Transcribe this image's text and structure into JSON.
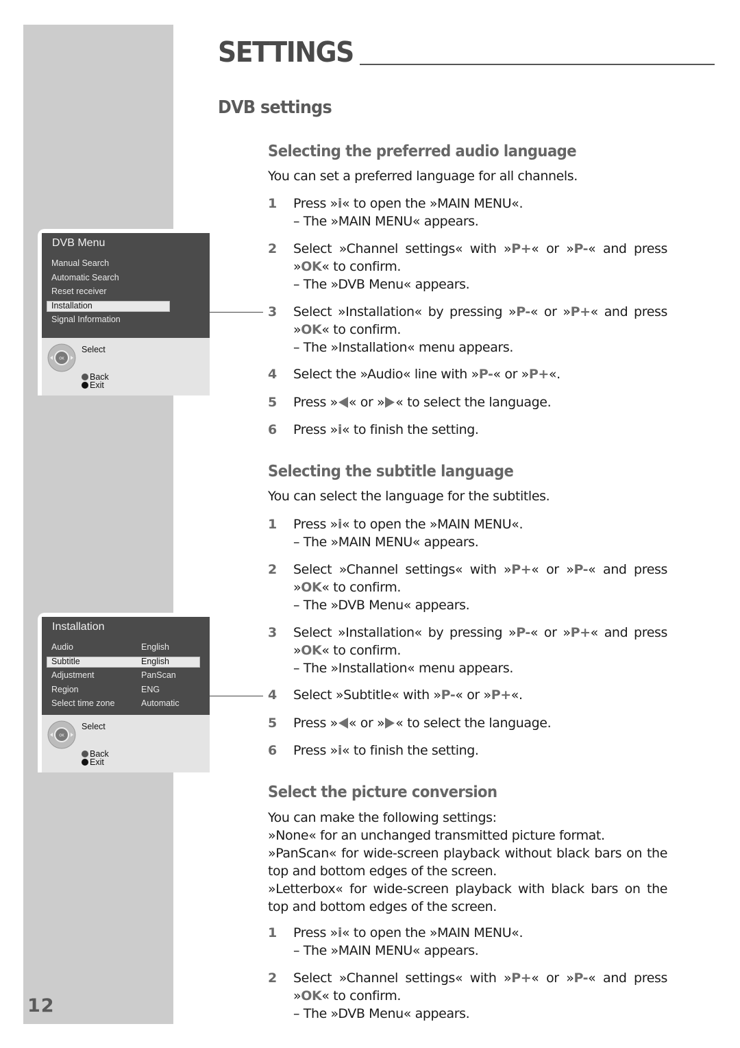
{
  "page": {
    "title": "SETTINGS",
    "section": "DVB settings",
    "page_number": "12"
  },
  "screens": {
    "dvb_menu": {
      "title": "DVB Menu",
      "items": [
        "Manual Search",
        "Automatic Search",
        "Reset receiver",
        "Installation",
        "Signal Information"
      ],
      "selected": "Installation",
      "hints": {
        "select": "Select",
        "back": "Back",
        "exit": "Exit"
      }
    },
    "installation": {
      "title": "Installation",
      "rows": [
        {
          "label": "Audio",
          "value": "English"
        },
        {
          "label": "Subtitle",
          "value": "English"
        },
        {
          "label": "Adjustment",
          "value": "PanScan"
        },
        {
          "label": "Region",
          "value": "ENG"
        },
        {
          "label": "Select time zone",
          "value": "Automatic"
        }
      ],
      "selected": "Subtitle",
      "hints": {
        "select": "Select",
        "back": "Back",
        "exit": "Exit"
      }
    }
  },
  "audio": {
    "heading": "Selecting the preferred audio language",
    "intro": "You can set a preferred language for all channels.",
    "steps": [
      {
        "n": "1",
        "a": "Press »",
        "k1": "i",
        "b": "« to open the »MAIN MENU«.",
        "result": "– The »MAIN MENU« appears."
      },
      {
        "n": "2",
        "a": "Select »Channel settings« with »",
        "k1": "P+",
        "b": "« or »",
        "k2": "P-",
        "c": "« and press »",
        "k3": "OK",
        "d": "« to confirm.",
        "result": "– The »DVB Menu« appears."
      },
      {
        "n": "3",
        "a": "Select »Installation« by pressing »",
        "k1": "P-",
        "b": "« or »",
        "k2": "P+",
        "c": "« and press »",
        "k3": "OK",
        "d": "« to confirm.",
        "result": "– The »Installation« menu appears."
      },
      {
        "n": "4",
        "a": "Select the »Audio« line with »",
        "k1": "P-",
        "b": "« or »",
        "k2": "P+",
        "c": "«."
      },
      {
        "n": "5",
        "a": "Press »",
        "b": "« or »",
        "c": "« to select the language."
      },
      {
        "n": "6",
        "a": "Press »",
        "k1": "i",
        "b": "« to finish the setting."
      }
    ]
  },
  "subtitle": {
    "heading": "Selecting the subtitle language",
    "intro": "You can select the language for the subtitles.",
    "steps": [
      {
        "n": "1",
        "a": "Press »",
        "k1": "i",
        "b": "« to open the »MAIN MENU«.",
        "result": "– The »MAIN MENU« appears."
      },
      {
        "n": "2",
        "a": "Select »Channel settings« with »",
        "k1": "P+",
        "b": "« or »",
        "k2": "P-",
        "c": "« and press »",
        "k3": "OK",
        "d": "« to confirm.",
        "result": "– The »DVB Menu« appears."
      },
      {
        "n": "3",
        "a": "Select »Installation« by pressing »",
        "k1": "P-",
        "b": "« or »",
        "k2": "P+",
        "c": "« and press »",
        "k3": "OK",
        "d": "« to confirm.",
        "result": "– The »Installation« menu appears."
      },
      {
        "n": "4",
        "a": "Select »Subtitle« with »",
        "k1": "P-",
        "b": "« or »",
        "k2": "P+",
        "c": "«."
      },
      {
        "n": "5",
        "a": "Press »",
        "b": "« or »",
        "c": "« to select the language."
      },
      {
        "n": "6",
        "a": "Press »",
        "k1": "i",
        "b": "« to finish the setting."
      }
    ]
  },
  "picture": {
    "heading": "Select the picture conversion",
    "intro": "You can make the following settings:",
    "options": [
      "»None« for an unchanged transmitted picture format.",
      "»PanScan« for wide-screen playback without black bars on the top and bottom edges of the screen.",
      "»Letterbox« for wide-screen playback with black bars on the top and bottom edges of the screen."
    ],
    "steps": [
      {
        "n": "1",
        "a": "Press »",
        "k1": "i",
        "b": "« to open the »MAIN MENU«.",
        "result": "– The »MAIN MENU« appears."
      },
      {
        "n": "2",
        "a": "Select »Channel settings« with »",
        "k1": "P+",
        "b": "« or »",
        "k2": "P-",
        "c": "« and press »",
        "k3": "OK",
        "d": "« to confirm.",
        "result": "– The »DVB Menu« appears."
      }
    ]
  }
}
